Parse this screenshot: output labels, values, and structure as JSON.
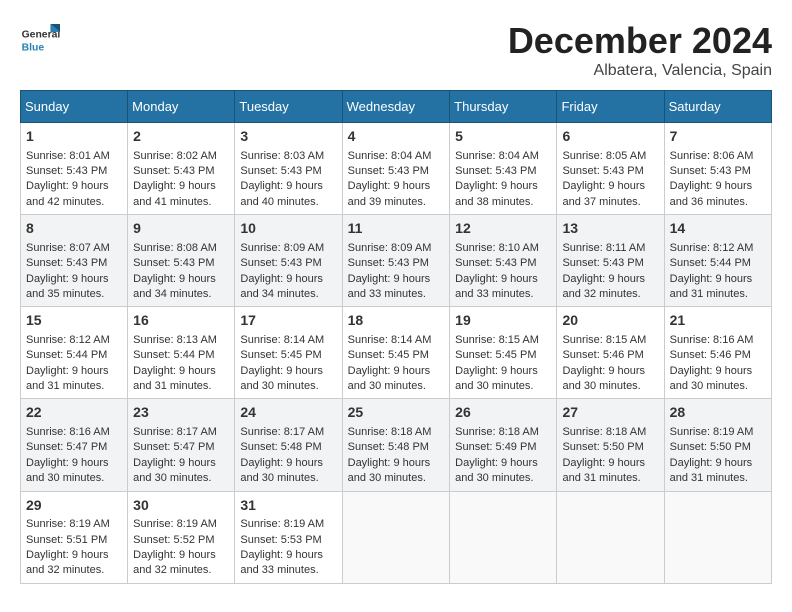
{
  "header": {
    "logo_general": "General",
    "logo_blue": "Blue",
    "title": "December 2024",
    "subtitle": "Albatera, Valencia, Spain"
  },
  "calendar": {
    "days_of_week": [
      "Sunday",
      "Monday",
      "Tuesday",
      "Wednesday",
      "Thursday",
      "Friday",
      "Saturday"
    ],
    "weeks": [
      [
        {
          "day": "",
          "info": ""
        },
        {
          "day": "2",
          "info": "Sunrise: 8:02 AM\nSunset: 5:43 PM\nDaylight: 9 hours and 41 minutes."
        },
        {
          "day": "3",
          "info": "Sunrise: 8:03 AM\nSunset: 5:43 PM\nDaylight: 9 hours and 40 minutes."
        },
        {
          "day": "4",
          "info": "Sunrise: 8:04 AM\nSunset: 5:43 PM\nDaylight: 9 hours and 39 minutes."
        },
        {
          "day": "5",
          "info": "Sunrise: 8:04 AM\nSunset: 5:43 PM\nDaylight: 9 hours and 38 minutes."
        },
        {
          "day": "6",
          "info": "Sunrise: 8:05 AM\nSunset: 5:43 PM\nDaylight: 9 hours and 37 minutes."
        },
        {
          "day": "7",
          "info": "Sunrise: 8:06 AM\nSunset: 5:43 PM\nDaylight: 9 hours and 36 minutes."
        }
      ],
      [
        {
          "day": "1",
          "info": "Sunrise: 8:01 AM\nSunset: 5:43 PM\nDaylight: 9 hours and 42 minutes.",
          "first_row_sun": true
        },
        {
          "day": "9",
          "info": "Sunrise: 8:08 AM\nSunset: 5:43 PM\nDaylight: 9 hours and 34 minutes."
        },
        {
          "day": "10",
          "info": "Sunrise: 8:09 AM\nSunset: 5:43 PM\nDaylight: 9 hours and 34 minutes."
        },
        {
          "day": "11",
          "info": "Sunrise: 8:09 AM\nSunset: 5:43 PM\nDaylight: 9 hours and 33 minutes."
        },
        {
          "day": "12",
          "info": "Sunrise: 8:10 AM\nSunset: 5:43 PM\nDaylight: 9 hours and 33 minutes."
        },
        {
          "day": "13",
          "info": "Sunrise: 8:11 AM\nSunset: 5:43 PM\nDaylight: 9 hours and 32 minutes."
        },
        {
          "day": "14",
          "info": "Sunrise: 8:12 AM\nSunset: 5:44 PM\nDaylight: 9 hours and 31 minutes."
        }
      ],
      [
        {
          "day": "8",
          "info": "Sunrise: 8:07 AM\nSunset: 5:43 PM\nDaylight: 9 hours and 35 minutes.",
          "first_row_sun2": true
        },
        {
          "day": "16",
          "info": "Sunrise: 8:13 AM\nSunset: 5:44 PM\nDaylight: 9 hours and 31 minutes."
        },
        {
          "day": "17",
          "info": "Sunrise: 8:14 AM\nSunset: 5:45 PM\nDaylight: 9 hours and 30 minutes."
        },
        {
          "day": "18",
          "info": "Sunrise: 8:14 AM\nSunset: 5:45 PM\nDaylight: 9 hours and 30 minutes."
        },
        {
          "day": "19",
          "info": "Sunrise: 8:15 AM\nSunset: 5:45 PM\nDaylight: 9 hours and 30 minutes."
        },
        {
          "day": "20",
          "info": "Sunrise: 8:15 AM\nSunset: 5:46 PM\nDaylight: 9 hours and 30 minutes."
        },
        {
          "day": "21",
          "info": "Sunrise: 8:16 AM\nSunset: 5:46 PM\nDaylight: 9 hours and 30 minutes."
        }
      ],
      [
        {
          "day": "15",
          "info": "Sunrise: 8:12 AM\nSunset: 5:44 PM\nDaylight: 9 hours and 31 minutes.",
          "sun3": true
        },
        {
          "day": "23",
          "info": "Sunrise: 8:17 AM\nSunset: 5:47 PM\nDaylight: 9 hours and 30 minutes."
        },
        {
          "day": "24",
          "info": "Sunrise: 8:17 AM\nSunset: 5:48 PM\nDaylight: 9 hours and 30 minutes."
        },
        {
          "day": "25",
          "info": "Sunrise: 8:18 AM\nSunset: 5:48 PM\nDaylight: 9 hours and 30 minutes."
        },
        {
          "day": "26",
          "info": "Sunrise: 8:18 AM\nSunset: 5:49 PM\nDaylight: 9 hours and 30 minutes."
        },
        {
          "day": "27",
          "info": "Sunrise: 8:18 AM\nSunset: 5:50 PM\nDaylight: 9 hours and 31 minutes."
        },
        {
          "day": "28",
          "info": "Sunrise: 8:19 AM\nSunset: 5:50 PM\nDaylight: 9 hours and 31 minutes."
        }
      ],
      [
        {
          "day": "22",
          "info": "Sunrise: 8:16 AM\nSunset: 5:47 PM\nDaylight: 9 hours and 30 minutes.",
          "sun4": true
        },
        {
          "day": "30",
          "info": "Sunrise: 8:19 AM\nSunset: 5:52 PM\nDaylight: 9 hours and 32 minutes."
        },
        {
          "day": "31",
          "info": "Sunrise: 8:19 AM\nSunset: 5:53 PM\nDaylight: 9 hours and 33 minutes."
        },
        {
          "day": "",
          "info": ""
        },
        {
          "day": "",
          "info": ""
        },
        {
          "day": "",
          "info": ""
        },
        {
          "day": "",
          "info": ""
        }
      ],
      [
        {
          "day": "29",
          "info": "Sunrise: 8:19 AM\nSunset: 5:51 PM\nDaylight: 9 hours and 32 minutes.",
          "sun5": true
        },
        {
          "day": "",
          "info": ""
        },
        {
          "day": "",
          "info": ""
        },
        {
          "day": "",
          "info": ""
        },
        {
          "day": "",
          "info": ""
        },
        {
          "day": "",
          "info": ""
        },
        {
          "day": "",
          "info": ""
        }
      ]
    ]
  }
}
